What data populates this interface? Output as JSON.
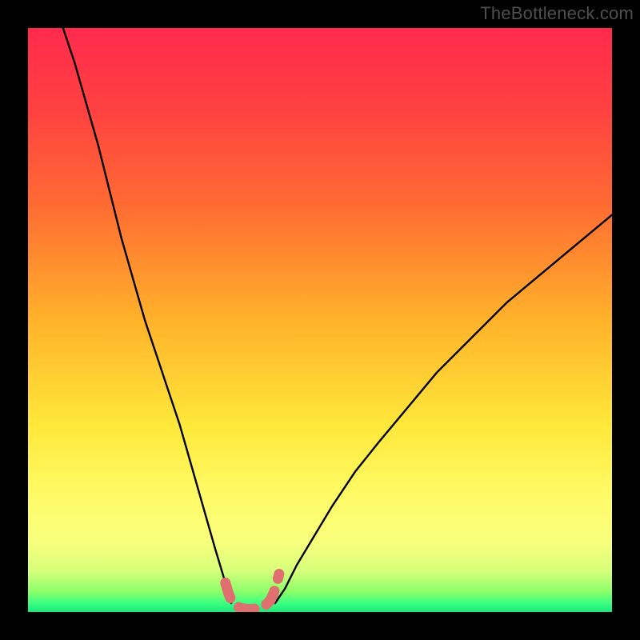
{
  "watermark": "TheBottleneck.com",
  "chart_data": {
    "type": "line",
    "title": "",
    "xlabel": "",
    "ylabel": "",
    "xlim": [
      0,
      100
    ],
    "ylim": [
      0,
      100
    ],
    "background_gradient_stops": [
      {
        "offset": 0,
        "color": "#ff2a4d"
      },
      {
        "offset": 0.14,
        "color": "#ff4141"
      },
      {
        "offset": 0.3,
        "color": "#ff6a33"
      },
      {
        "offset": 0.5,
        "color": "#ffb22a"
      },
      {
        "offset": 0.68,
        "color": "#ffe83a"
      },
      {
        "offset": 0.8,
        "color": "#fffb66"
      },
      {
        "offset": 0.88,
        "color": "#f8ff7d"
      },
      {
        "offset": 0.93,
        "color": "#d6ff7a"
      },
      {
        "offset": 0.965,
        "color": "#8cff6a"
      },
      {
        "offset": 0.985,
        "color": "#3cff82"
      },
      {
        "offset": 1.0,
        "color": "#18e87a"
      }
    ],
    "series": [
      {
        "name": "left-branch",
        "x": [
          6,
          8,
          10,
          12,
          14,
          16,
          18,
          20,
          22,
          24,
          26,
          28,
          30,
          32,
          33.5,
          34.8
        ],
        "y": [
          100,
          94,
          87,
          80,
          72,
          64,
          57,
          50,
          44,
          38,
          32,
          25,
          18,
          11,
          6,
          1.5
        ],
        "stroke": "#000000",
        "stroke_width": 2.4
      },
      {
        "name": "right-branch",
        "x": [
          42.3,
          44,
          46,
          49,
          52,
          56,
          60,
          65,
          70,
          76,
          82,
          88,
          94,
          100
        ],
        "y": [
          1.5,
          4,
          8,
          13,
          18,
          24,
          29,
          35,
          41,
          47,
          53,
          58,
          63,
          68
        ],
        "stroke": "#000000",
        "stroke_width": 2.4
      },
      {
        "name": "bottom-highlight",
        "x": [
          33.8,
          34.3,
          34.8,
          35.5,
          36.3,
          37.3,
          38.5,
          39.7,
          40.7,
          41.5,
          42.1,
          42.6,
          43.0
        ],
        "y": [
          5.0,
          3.3,
          2.0,
          1.2,
          0.7,
          0.5,
          0.5,
          0.7,
          1.2,
          2.0,
          3.3,
          5.0,
          6.5
        ],
        "stroke": "#e07070",
        "stroke_width": 13,
        "dashed": true
      }
    ]
  }
}
